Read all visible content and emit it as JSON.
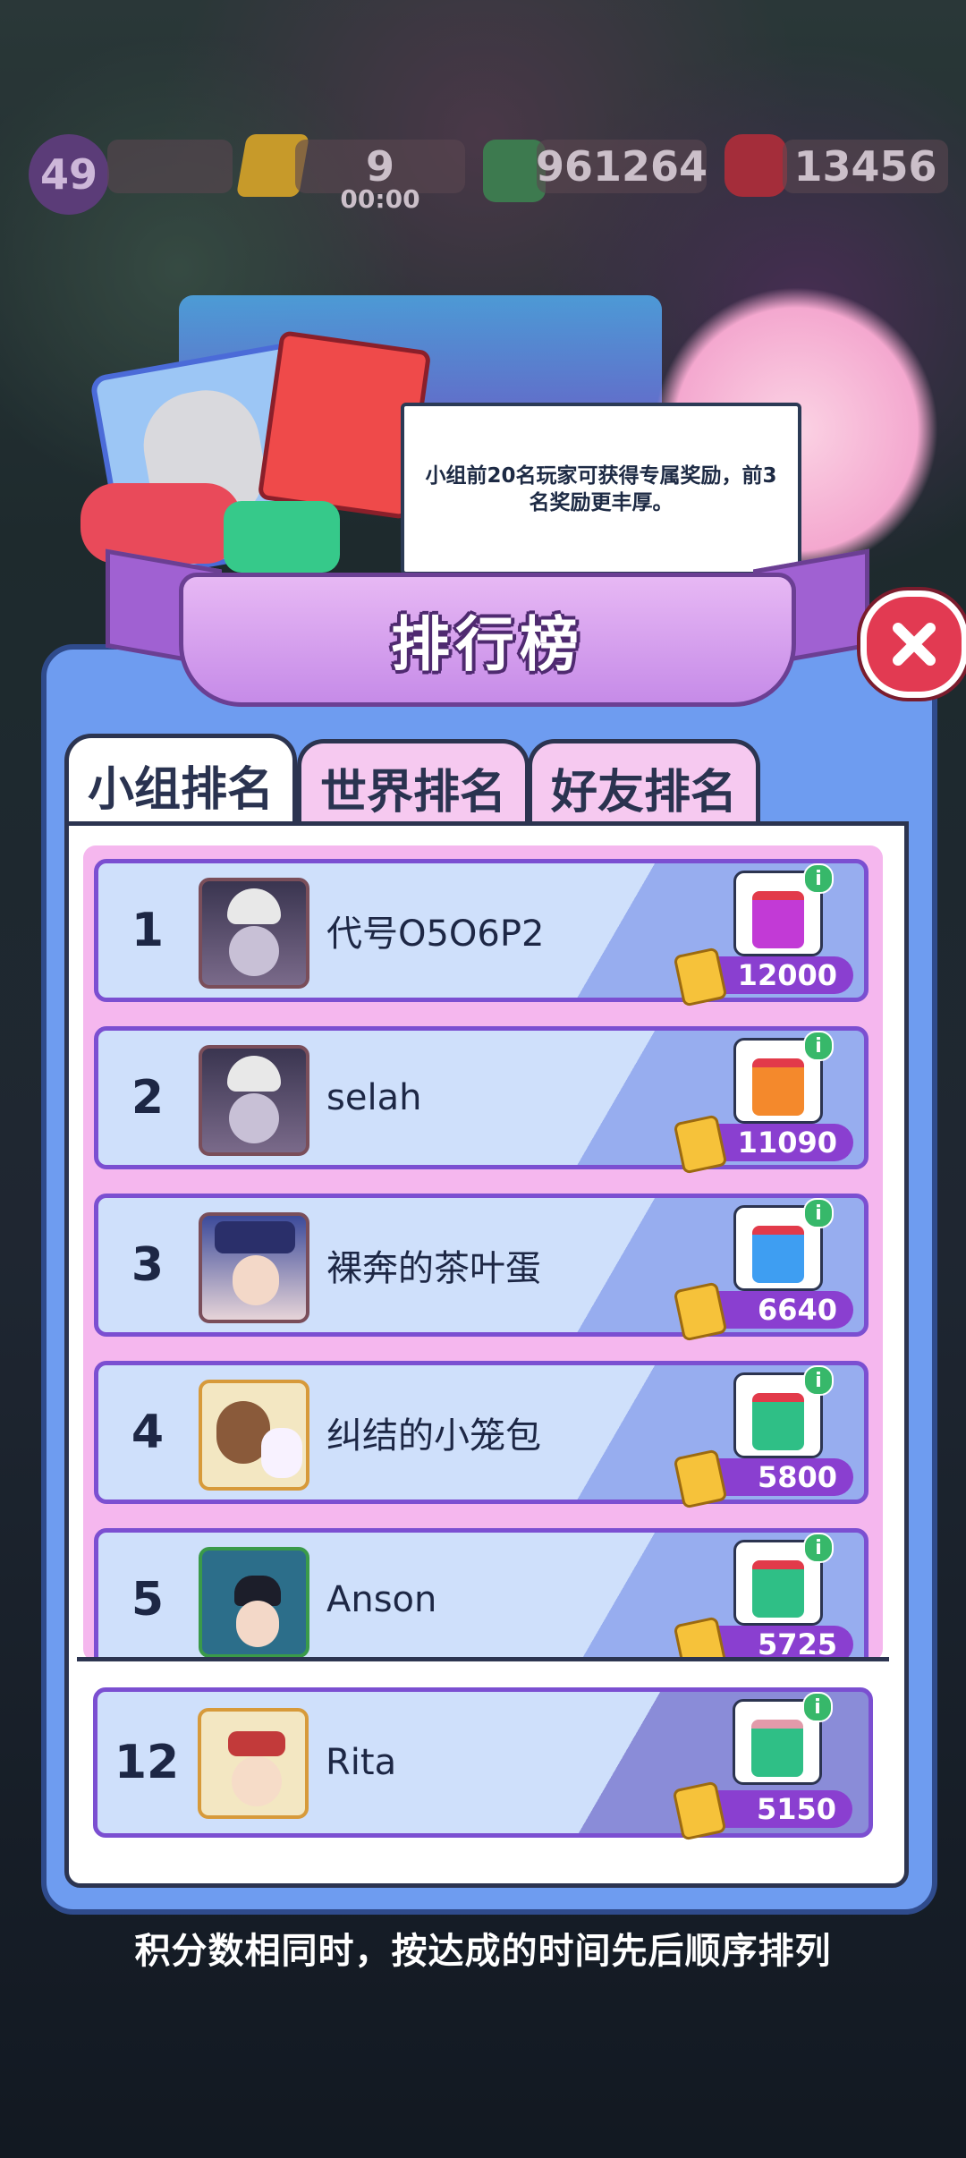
{
  "hud": {
    "level": "49",
    "energy_value": "9",
    "energy_timer": "00:00",
    "cash": "961264",
    "gems": "13456"
  },
  "bubble_text": "小组前20名玩家可获得专属奖励，前3名奖励更丰厚。",
  "title": "排行榜",
  "tabs": [
    {
      "label": "小组排名",
      "active": true
    },
    {
      "label": "世界排名",
      "active": false
    },
    {
      "label": "好友排名",
      "active": false
    }
  ],
  "rankings": [
    {
      "rank": "1",
      "name": "代号O5O6P2",
      "score": "12000",
      "gift_color": "#c23ad6",
      "info": "i"
    },
    {
      "rank": "2",
      "name": "selah",
      "score": "11090",
      "gift_color": "#f4892c",
      "info": "i"
    },
    {
      "rank": "3",
      "name": "裸奔的茶叶蛋",
      "score": "6640",
      "gift_color": "#3e9ef2",
      "info": "i"
    },
    {
      "rank": "4",
      "name": "纠结的小笼包",
      "score": "5800",
      "gift_color": "#2fbf86",
      "info": "i"
    },
    {
      "rank": "5",
      "name": "Anson",
      "score": "5725",
      "gift_color": "#2fbf86",
      "info": "i"
    }
  ],
  "self_entry": {
    "rank": "12",
    "name": "Rita",
    "score": "5150",
    "gift_color": "#2fbf86",
    "info": "i"
  },
  "footer_note": "积分数相同时，按达成的时间先后顺序排列",
  "colors": {
    "panel": "#6e9cf0",
    "score_pill": "#8a3fd0",
    "close": "#e23a52"
  }
}
